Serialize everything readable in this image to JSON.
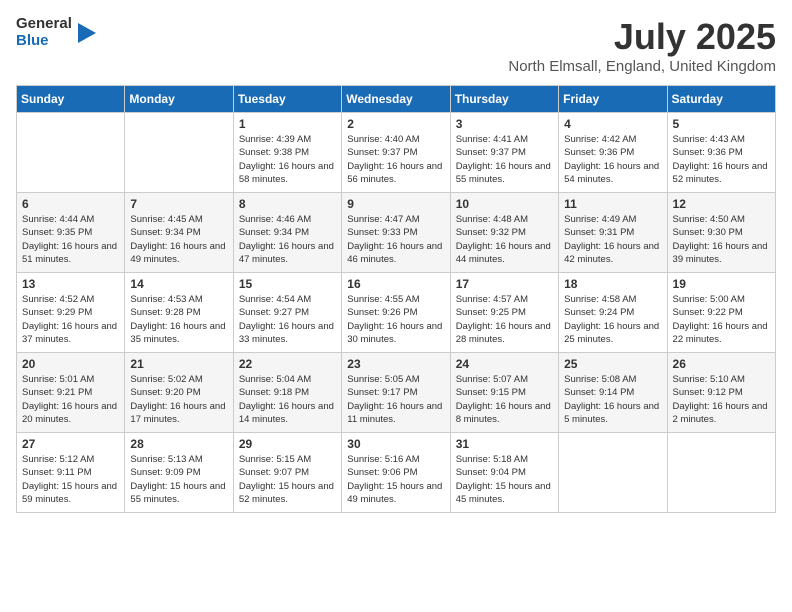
{
  "header": {
    "logo_general": "General",
    "logo_blue": "Blue",
    "title": "July 2025",
    "location": "North Elmsall, England, United Kingdom"
  },
  "days_of_week": [
    "Sunday",
    "Monday",
    "Tuesday",
    "Wednesday",
    "Thursday",
    "Friday",
    "Saturday"
  ],
  "weeks": [
    [
      {
        "day": "",
        "sunrise": "",
        "sunset": "",
        "daylight": ""
      },
      {
        "day": "",
        "sunrise": "",
        "sunset": "",
        "daylight": ""
      },
      {
        "day": "1",
        "sunrise": "Sunrise: 4:39 AM",
        "sunset": "Sunset: 9:38 PM",
        "daylight": "Daylight: 16 hours and 58 minutes."
      },
      {
        "day": "2",
        "sunrise": "Sunrise: 4:40 AM",
        "sunset": "Sunset: 9:37 PM",
        "daylight": "Daylight: 16 hours and 56 minutes."
      },
      {
        "day": "3",
        "sunrise": "Sunrise: 4:41 AM",
        "sunset": "Sunset: 9:37 PM",
        "daylight": "Daylight: 16 hours and 55 minutes."
      },
      {
        "day": "4",
        "sunrise": "Sunrise: 4:42 AM",
        "sunset": "Sunset: 9:36 PM",
        "daylight": "Daylight: 16 hours and 54 minutes."
      },
      {
        "day": "5",
        "sunrise": "Sunrise: 4:43 AM",
        "sunset": "Sunset: 9:36 PM",
        "daylight": "Daylight: 16 hours and 52 minutes."
      }
    ],
    [
      {
        "day": "6",
        "sunrise": "Sunrise: 4:44 AM",
        "sunset": "Sunset: 9:35 PM",
        "daylight": "Daylight: 16 hours and 51 minutes."
      },
      {
        "day": "7",
        "sunrise": "Sunrise: 4:45 AM",
        "sunset": "Sunset: 9:34 PM",
        "daylight": "Daylight: 16 hours and 49 minutes."
      },
      {
        "day": "8",
        "sunrise": "Sunrise: 4:46 AM",
        "sunset": "Sunset: 9:34 PM",
        "daylight": "Daylight: 16 hours and 47 minutes."
      },
      {
        "day": "9",
        "sunrise": "Sunrise: 4:47 AM",
        "sunset": "Sunset: 9:33 PM",
        "daylight": "Daylight: 16 hours and 46 minutes."
      },
      {
        "day": "10",
        "sunrise": "Sunrise: 4:48 AM",
        "sunset": "Sunset: 9:32 PM",
        "daylight": "Daylight: 16 hours and 44 minutes."
      },
      {
        "day": "11",
        "sunrise": "Sunrise: 4:49 AM",
        "sunset": "Sunset: 9:31 PM",
        "daylight": "Daylight: 16 hours and 42 minutes."
      },
      {
        "day": "12",
        "sunrise": "Sunrise: 4:50 AM",
        "sunset": "Sunset: 9:30 PM",
        "daylight": "Daylight: 16 hours and 39 minutes."
      }
    ],
    [
      {
        "day": "13",
        "sunrise": "Sunrise: 4:52 AM",
        "sunset": "Sunset: 9:29 PM",
        "daylight": "Daylight: 16 hours and 37 minutes."
      },
      {
        "day": "14",
        "sunrise": "Sunrise: 4:53 AM",
        "sunset": "Sunset: 9:28 PM",
        "daylight": "Daylight: 16 hours and 35 minutes."
      },
      {
        "day": "15",
        "sunrise": "Sunrise: 4:54 AM",
        "sunset": "Sunset: 9:27 PM",
        "daylight": "Daylight: 16 hours and 33 minutes."
      },
      {
        "day": "16",
        "sunrise": "Sunrise: 4:55 AM",
        "sunset": "Sunset: 9:26 PM",
        "daylight": "Daylight: 16 hours and 30 minutes."
      },
      {
        "day": "17",
        "sunrise": "Sunrise: 4:57 AM",
        "sunset": "Sunset: 9:25 PM",
        "daylight": "Daylight: 16 hours and 28 minutes."
      },
      {
        "day": "18",
        "sunrise": "Sunrise: 4:58 AM",
        "sunset": "Sunset: 9:24 PM",
        "daylight": "Daylight: 16 hours and 25 minutes."
      },
      {
        "day": "19",
        "sunrise": "Sunrise: 5:00 AM",
        "sunset": "Sunset: 9:22 PM",
        "daylight": "Daylight: 16 hours and 22 minutes."
      }
    ],
    [
      {
        "day": "20",
        "sunrise": "Sunrise: 5:01 AM",
        "sunset": "Sunset: 9:21 PM",
        "daylight": "Daylight: 16 hours and 20 minutes."
      },
      {
        "day": "21",
        "sunrise": "Sunrise: 5:02 AM",
        "sunset": "Sunset: 9:20 PM",
        "daylight": "Daylight: 16 hours and 17 minutes."
      },
      {
        "day": "22",
        "sunrise": "Sunrise: 5:04 AM",
        "sunset": "Sunset: 9:18 PM",
        "daylight": "Daylight: 16 hours and 14 minutes."
      },
      {
        "day": "23",
        "sunrise": "Sunrise: 5:05 AM",
        "sunset": "Sunset: 9:17 PM",
        "daylight": "Daylight: 16 hours and 11 minutes."
      },
      {
        "day": "24",
        "sunrise": "Sunrise: 5:07 AM",
        "sunset": "Sunset: 9:15 PM",
        "daylight": "Daylight: 16 hours and 8 minutes."
      },
      {
        "day": "25",
        "sunrise": "Sunrise: 5:08 AM",
        "sunset": "Sunset: 9:14 PM",
        "daylight": "Daylight: 16 hours and 5 minutes."
      },
      {
        "day": "26",
        "sunrise": "Sunrise: 5:10 AM",
        "sunset": "Sunset: 9:12 PM",
        "daylight": "Daylight: 16 hours and 2 minutes."
      }
    ],
    [
      {
        "day": "27",
        "sunrise": "Sunrise: 5:12 AM",
        "sunset": "Sunset: 9:11 PM",
        "daylight": "Daylight: 15 hours and 59 minutes."
      },
      {
        "day": "28",
        "sunrise": "Sunrise: 5:13 AM",
        "sunset": "Sunset: 9:09 PM",
        "daylight": "Daylight: 15 hours and 55 minutes."
      },
      {
        "day": "29",
        "sunrise": "Sunrise: 5:15 AM",
        "sunset": "Sunset: 9:07 PM",
        "daylight": "Daylight: 15 hours and 52 minutes."
      },
      {
        "day": "30",
        "sunrise": "Sunrise: 5:16 AM",
        "sunset": "Sunset: 9:06 PM",
        "daylight": "Daylight: 15 hours and 49 minutes."
      },
      {
        "day": "31",
        "sunrise": "Sunrise: 5:18 AM",
        "sunset": "Sunset: 9:04 PM",
        "daylight": "Daylight: 15 hours and 45 minutes."
      },
      {
        "day": "",
        "sunrise": "",
        "sunset": "",
        "daylight": ""
      },
      {
        "day": "",
        "sunrise": "",
        "sunset": "",
        "daylight": ""
      }
    ]
  ]
}
